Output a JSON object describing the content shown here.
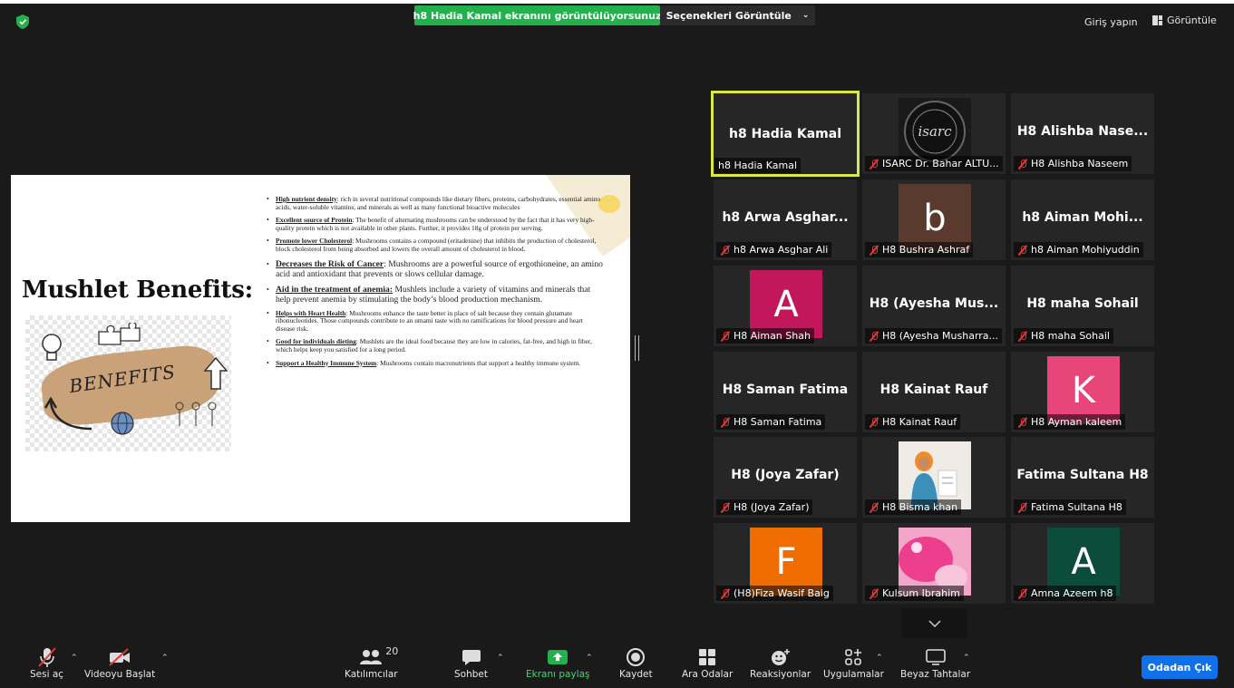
{
  "top_bar": {
    "share_banner": "h8 Hadia Kamal ekranını görüntülüyorsunuz",
    "view_options": "Seçenekleri Görüntüle",
    "login": "Giriş yapın",
    "view": "Görüntüle"
  },
  "slide": {
    "title": "Mushlet Benefits:",
    "image_text": "BENEFITS",
    "bullets": [
      {
        "title": "High nutrient density",
        "text": ": rich in several nutritional compounds like dietary fibers, proteins, carbohydrates, essential amino acids, water-soluble vitamins, and minerals as well as many functional bioactive molecules"
      },
      {
        "title": "Excellent source of Protein",
        "text": ": The benefit of alternating mushrooms can be understood by the fact that it has very high-quality protein which is not available in other plants. Further, it provides 18g of protein per serving."
      },
      {
        "title": "Promote lower Cholesterol",
        "text": ": Mushrooms contains a compound (eritadenine) that inhibits the production of cholesterol, block cholesterol from being absorbed and lowers the overall amount of cholesterol in blood."
      },
      {
        "title": "Decreases the Risk of Cancer",
        "text": ": Mushrooms are a powerful source of ergothioneine, an amino acid and antioxidant that prevents or slows cellular damage."
      },
      {
        "title": "Aid in the treatment of anemia:",
        "text": " Mushlets include a variety of vitamins and minerals that help prevent  anemia by stimulating the body’s blood production mechanism."
      },
      {
        "title": "Helps with Heart Health",
        "text": ": Mushrooms enhance the taste better in place of salt because they contain glutamate ribonucleotides. Those compounds contribute to an umami taste with no ramifications for blood pressure and heart disease risk."
      },
      {
        "title": "Good for individuals dieting",
        "text": ": Mushlets are the ideal food because they are low in calories, fat-free, and  high in fiber, which helps keep you satisfied for a long period."
      },
      {
        "title": "Support a Healthy Immune System",
        "text": ": Mushrooms contain macronutrients that support a healthy immune system."
      }
    ]
  },
  "participants": [
    {
      "big_name": "h8 Hadia Kamal",
      "label": "h8 Hadia Kamal",
      "muted": false,
      "active": true
    },
    {
      "big_name": "",
      "label": "ISARC Dr. Bahar ALTU...",
      "muted": true,
      "logo_text": "isarc"
    },
    {
      "big_name": "H8 Alishba Nase...",
      "label": "H8 Alishba Naseem",
      "muted": true
    },
    {
      "big_name": "h8 Arwa Asghar...",
      "label": "h8 Arwa Asghar Ali",
      "muted": true
    },
    {
      "big_name": "",
      "label": "H8 Bushra Ashraf",
      "muted": true,
      "avatar": "b",
      "avatar_color": "#5b3a2e"
    },
    {
      "big_name": "h8 Aiman Mohi...",
      "label": "h8 Aiman Mohiyuddin",
      "muted": true
    },
    {
      "big_name": "",
      "label": "H8 Aiman Shah",
      "muted": true,
      "avatar": "A",
      "avatar_color": "#c2185b"
    },
    {
      "big_name": "H8 (Ayesha Mus...",
      "label": "H8 (Ayesha Musharra...",
      "muted": true
    },
    {
      "big_name": "H8 maha Sohail",
      "label": "H8 maha Sohail",
      "muted": true
    },
    {
      "big_name": "H8 Saman Fatima",
      "label": "H8 Saman Fatima",
      "muted": true
    },
    {
      "big_name": "H8 Kainat Rauf",
      "label": "H8 Kainat Rauf",
      "muted": true
    },
    {
      "big_name": "",
      "label": "H8 Ayman kaleem",
      "muted": true,
      "avatar": "K",
      "avatar_color": "#e8457a"
    },
    {
      "big_name": "H8 (Joya Zafar)",
      "label": "H8 (Joya Zafar)",
      "muted": true
    },
    {
      "big_name": "",
      "label": "H8 Bisma khan",
      "muted": true,
      "photo": "person"
    },
    {
      "big_name": "Fatima Sultana H8",
      "label": "Fatima Sultana H8",
      "muted": true
    },
    {
      "big_name": "",
      "label": "(H8)Fiza Wasif Baig",
      "muted": true,
      "avatar": "F",
      "avatar_color": "#ef6c00"
    },
    {
      "big_name": "",
      "label": "Kulsum Ibrahim",
      "muted": true,
      "photo": "pink"
    },
    {
      "big_name": "",
      "label": "Amna Azeem h8",
      "muted": true,
      "avatar": "A",
      "avatar_color": "#0b4d3a"
    }
  ],
  "toolbar": {
    "mute": "Sesi aç",
    "video": "Videoyu Başlat",
    "participants": "Katılımcılar",
    "participants_count": "20",
    "chat": "Sohbet",
    "share": "Ekranı paylaş",
    "record": "Kaydet",
    "breakout": "Ara Odalar",
    "reactions": "Reaksiyonlar",
    "apps": "Uygulamalar",
    "whiteboards": "Beyaz Tahtalar",
    "leave": "Odadan Çık"
  },
  "colors": {
    "share_green": "#22b14c",
    "active_border": "#d8e84a",
    "leave_blue": "#0e71eb",
    "muted_red": "#e03b3b"
  }
}
